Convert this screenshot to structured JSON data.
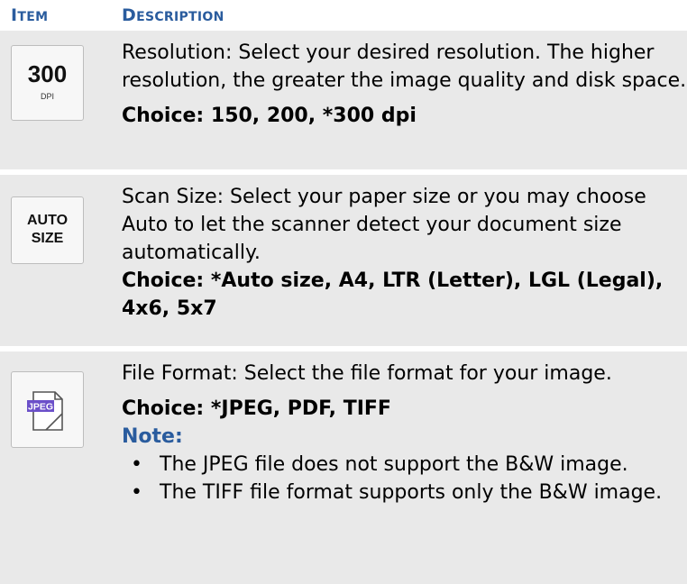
{
  "header": {
    "item_big": "I",
    "item_small": "TEM",
    "desc_big": "D",
    "desc_small": "ESCRIPTION"
  },
  "rows": [
    {
      "icon": {
        "type": "resolution-300-dpi-icon",
        "big": "300",
        "small": "DPI"
      },
      "text": "Resolution: Select your desired resolution. The higher resolution, the greater the image quality and disk space.",
      "choice": "Choice: 150, 200, *300 dpi"
    },
    {
      "icon": {
        "type": "auto-size-icon",
        "line1": "AUTO",
        "line2": "SIZE"
      },
      "text": "Scan Size: Select your paper size or you may choose Auto to let the scanner detect your document size automatically.",
      "choice": "Choice: *Auto size, A4, LTR (Letter), LGL (Legal), 4x6, 5x7"
    },
    {
      "icon": {
        "type": "jpeg-file-icon",
        "label": "JPEG"
      },
      "text": "File Format: Select the file format for your image.",
      "choice": "Choice: *JPEG, PDF, TIFF",
      "note_title": "Note:",
      "notes": [
        "The JPEG file does not support the B&W image.",
        "The TIFF file format supports only the B&W image."
      ]
    }
  ],
  "colors": {
    "header": "#2a5c9e",
    "row_bg": "#e9e9e9",
    "icon_border": "#bdbdbd",
    "jpeg_badge": "#6b4fc9"
  }
}
